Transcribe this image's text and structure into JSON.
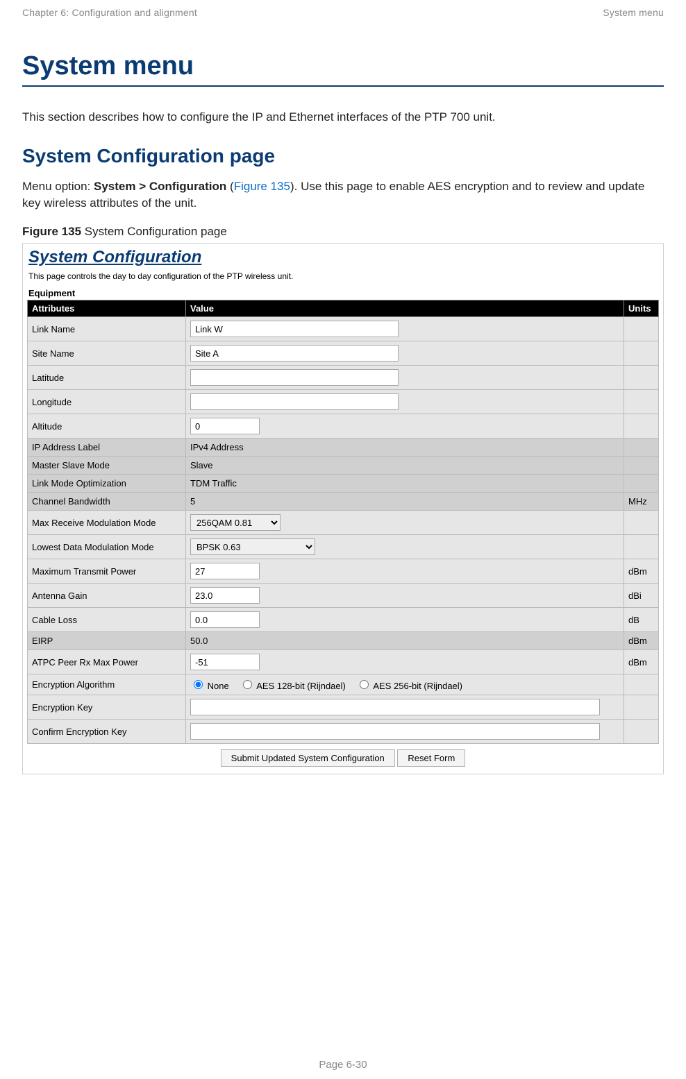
{
  "header": {
    "left": "Chapter 6:  Configuration and alignment",
    "right": "System menu"
  },
  "title": "System menu",
  "intro": "This section describes how to configure the IP and Ethernet interfaces of the PTP 700 unit.",
  "section_heading": "System Configuration page",
  "menu_opt": {
    "prefix": "Menu option: ",
    "cmd": "System > Configuration",
    "open_paren": " (",
    "figref": "Figure 135",
    "close_paren": "). ",
    "rest": "Use this page to enable AES encryption and to review and update key wireless attributes of the unit."
  },
  "figure_caption": {
    "label": "Figure 135",
    "rest": "  System Configuration page"
  },
  "panel": {
    "title": "System Configuration",
    "subtitle": "This page controls the day to day configuration of the PTP wireless unit.",
    "equipment_label": "Equipment",
    "th": {
      "attr": "Attributes",
      "val": "Value",
      "units": "Units"
    },
    "rows": {
      "link_name": {
        "label": "Link Name",
        "value": "Link W",
        "units": ""
      },
      "site_name": {
        "label": "Site Name",
        "value": "Site A",
        "units": ""
      },
      "latitude": {
        "label": "Latitude",
        "value": "",
        "units": ""
      },
      "longitude": {
        "label": "Longitude",
        "value": "",
        "units": ""
      },
      "altitude": {
        "label": "Altitude",
        "value": "0",
        "units": ""
      },
      "ip_label": {
        "label": "IP Address Label",
        "value": "IPv4 Address",
        "units": ""
      },
      "ms_mode": {
        "label": "Master Slave Mode",
        "value": "Slave",
        "units": ""
      },
      "link_mode": {
        "label": "Link Mode Optimization",
        "value": "TDM Traffic",
        "units": ""
      },
      "chan_bw": {
        "label": "Channel Bandwidth",
        "value": "5",
        "units": "MHz"
      },
      "max_rx_mod": {
        "label": "Max Receive Modulation Mode",
        "value": "256QAM 0.81",
        "units": ""
      },
      "low_mod": {
        "label": "Lowest Data Modulation Mode",
        "value": "BPSK 0.63",
        "units": ""
      },
      "max_tx_pwr": {
        "label": "Maximum Transmit Power",
        "value": "27",
        "units": "dBm"
      },
      "ant_gain": {
        "label": "Antenna Gain",
        "value": "23.0",
        "units": "dBi"
      },
      "cable_loss": {
        "label": "Cable Loss",
        "value": "0.0",
        "units": "dB"
      },
      "eirp": {
        "label": "EIRP",
        "value": "50.0",
        "units": "dBm"
      },
      "atpc": {
        "label": "ATPC Peer Rx Max Power",
        "value": "-51",
        "units": "dBm"
      },
      "enc_alg": {
        "label": "Encryption Algorithm",
        "opts": {
          "none": "None",
          "aes128": "AES 128-bit (Rijndael)",
          "aes256": "AES 256-bit (Rijndael)"
        },
        "units": ""
      },
      "enc_key": {
        "label": "Encryption Key",
        "value": "",
        "units": ""
      },
      "enc_key2": {
        "label": "Confirm Encryption Key",
        "value": "",
        "units": ""
      }
    },
    "submit_label": "Submit Updated System Configuration",
    "reset_label": "Reset Form"
  },
  "footer": "Page 6-30"
}
